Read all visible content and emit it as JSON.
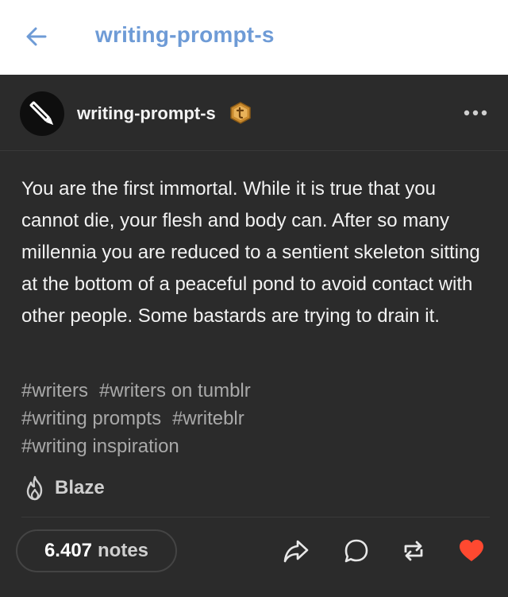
{
  "header": {
    "title": "writing-prompt-s",
    "back_icon": "arrow-left-icon"
  },
  "post": {
    "blog_name": "writing-prompt-s",
    "badge_icon": "tumblr-badge-icon",
    "more_icon": "ellipsis-icon",
    "body": "You are the first immortal. While it is true that you cannot die, your flesh and body can. After so many millennia you are reduced to a sentient skeleton sitting at the bottom of a peaceful pond to avoid contact with other people. Some bastards are trying to drain it.",
    "tags": [
      "#writers",
      "#writers on tumblr",
      "#writing prompts",
      "#writeblr",
      "#writing inspiration"
    ],
    "blaze_label": "Blaze",
    "notes_count": "6.407",
    "notes_label": "notes",
    "actions": [
      "share-icon",
      "reply-icon",
      "reblog-icon",
      "heart-icon"
    ]
  },
  "colors": {
    "accent": "#6e9bd6",
    "post_background": "#2b2b2b",
    "like": "#ff4930"
  }
}
